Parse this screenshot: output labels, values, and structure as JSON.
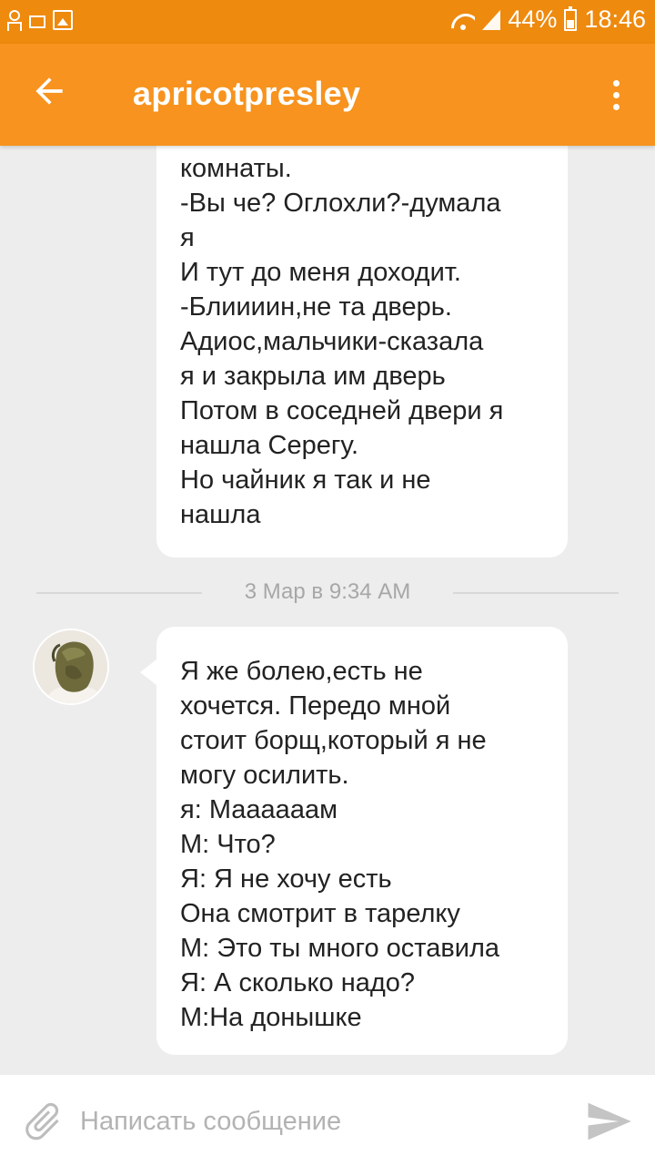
{
  "status_bar": {
    "battery": "44%",
    "time": "18:46"
  },
  "header": {
    "title": "apricotpresley"
  },
  "messages": [
    {
      "lines": [
        "комнаты.",
        "-Вы че? Оглохли?-думала",
        "я",
        "И тут до меня доходит.",
        "-Блиииин,не та дверь.",
        "Адиос,мальчики-сказала",
        "я и закрыла им дверь",
        "Потом в соседней двери я",
        "нашла Серегу.",
        "Но чайник я так и не",
        "нашла"
      ]
    },
    {
      "lines": [
        "Я же  болею,есть не",
        "хочется. Передо мной",
        "стоит борщ,который я не",
        "могу осилить.",
        "я: Маааааам",
        "М: Что?",
        "Я: Я не хочу есть",
        "Она смотрит в тарелку",
        "М: Это ты много оставила",
        "Я: А сколько надо?",
        "М:На донышке"
      ]
    }
  ],
  "date_separator": "3 Мар в 9:34 AM",
  "composer": {
    "placeholder": "Написать сообщение"
  },
  "colors": {
    "status_bar": "#ee8a0e",
    "app_bar": "#f7931e",
    "background": "#ededed",
    "bubble": "#ffffff"
  },
  "icons": {
    "back": "arrow-left-icon",
    "menu": "more-vert-icon",
    "attach": "paperclip-icon",
    "send": "send-icon"
  }
}
